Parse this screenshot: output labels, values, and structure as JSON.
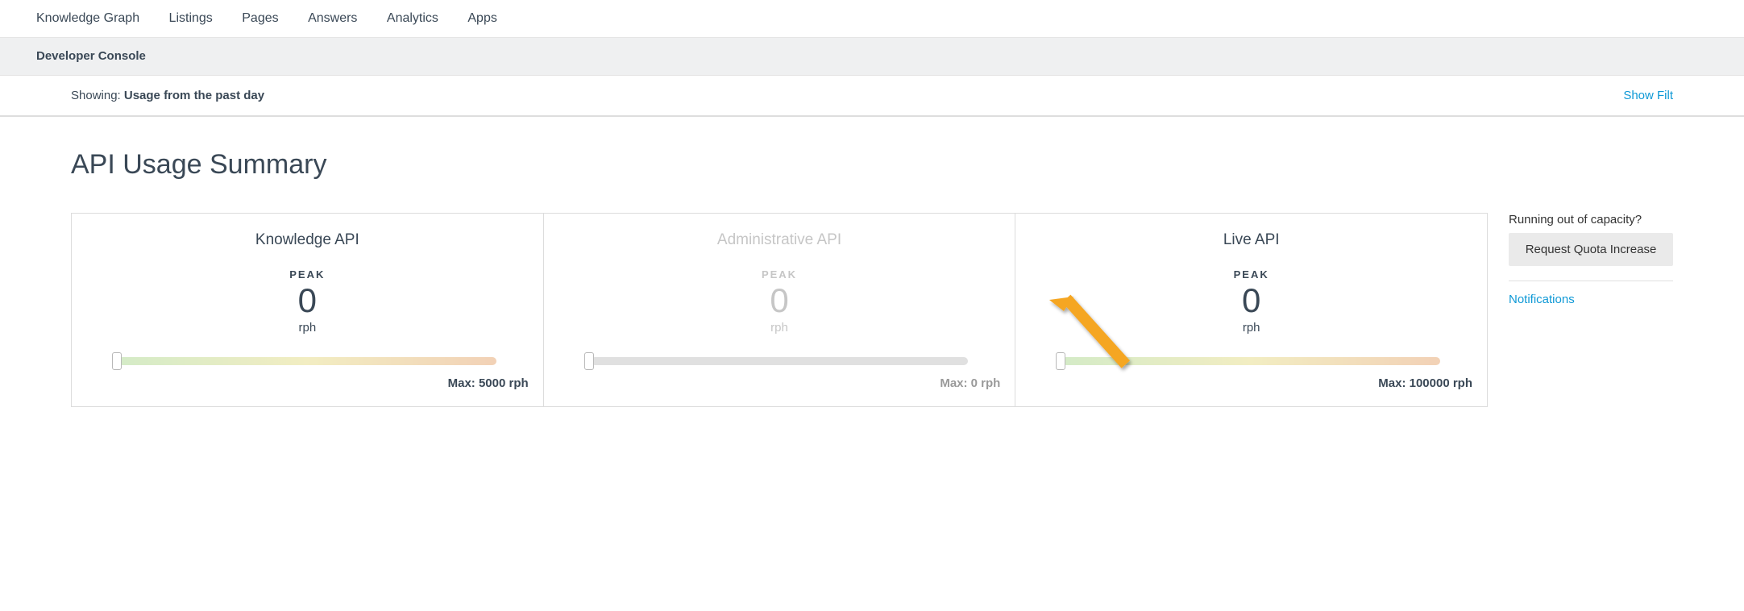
{
  "nav": {
    "items": [
      "Knowledge Graph",
      "Listings",
      "Pages",
      "Answers",
      "Analytics",
      "Apps"
    ]
  },
  "subnav": {
    "item": "Developer Console"
  },
  "filter": {
    "label": "Showing: ",
    "value": "Usage from the past day",
    "show_filters": "Show Filt"
  },
  "page": {
    "title": "API Usage Summary"
  },
  "cards": [
    {
      "title": "Knowledge API",
      "peak_label": "PEAK",
      "peak_value": "0",
      "unit": "rph",
      "max_label": "Max: 5000 rph",
      "disabled": false
    },
    {
      "title": "Administrative API",
      "peak_label": "PEAK",
      "peak_value": "0",
      "unit": "rph",
      "max_label": "Max: 0 rph",
      "disabled": true
    },
    {
      "title": "Live API",
      "peak_label": "PEAK",
      "peak_value": "0",
      "unit": "rph",
      "max_label": "Max: 100000 rph",
      "disabled": false
    }
  ],
  "sidebar": {
    "capacity_text": "Running out of capacity?",
    "request_button": "Request Quota Increase",
    "notifications": "Notifications"
  }
}
